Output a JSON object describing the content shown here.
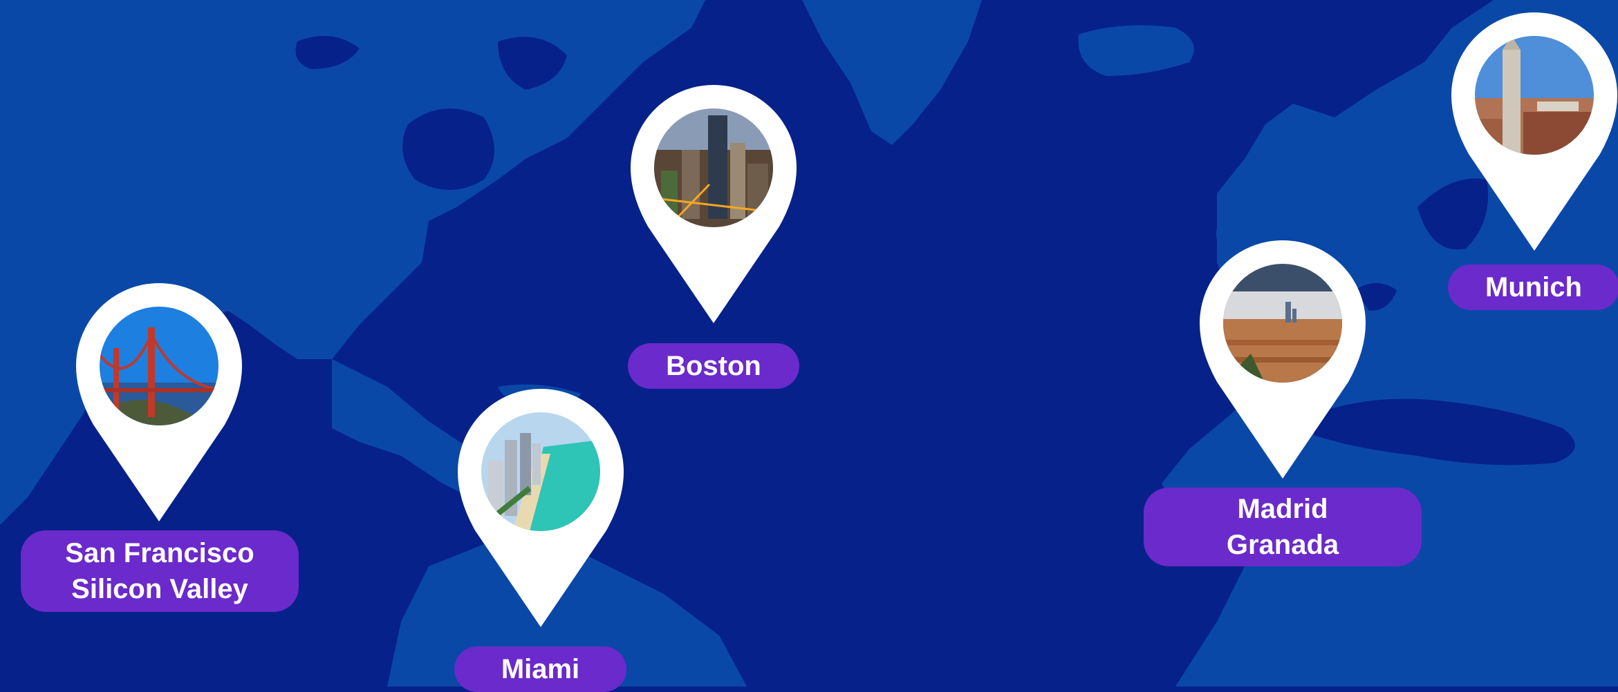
{
  "colors": {
    "ocean": "#07218a",
    "land": "#0a48a8",
    "pin": "#ffffff",
    "label_bg": "#6b2acb",
    "label_text": "#ffffff"
  },
  "locations": [
    {
      "id": "san-francisco",
      "lines": [
        "San Francisco",
        "Silicon Valley"
      ],
      "photo": "golden-gate-bridge"
    },
    {
      "id": "boston",
      "lines": [
        "Boston"
      ],
      "photo": "boston-skyline"
    },
    {
      "id": "miami",
      "lines": [
        "Miami"
      ],
      "photo": "miami-beach"
    },
    {
      "id": "madrid",
      "lines": [
        "Madrid",
        "Granada"
      ],
      "photo": "madrid-cityscape"
    },
    {
      "id": "munich",
      "lines": [
        "Munich"
      ],
      "photo": "munich-town-hall"
    }
  ]
}
